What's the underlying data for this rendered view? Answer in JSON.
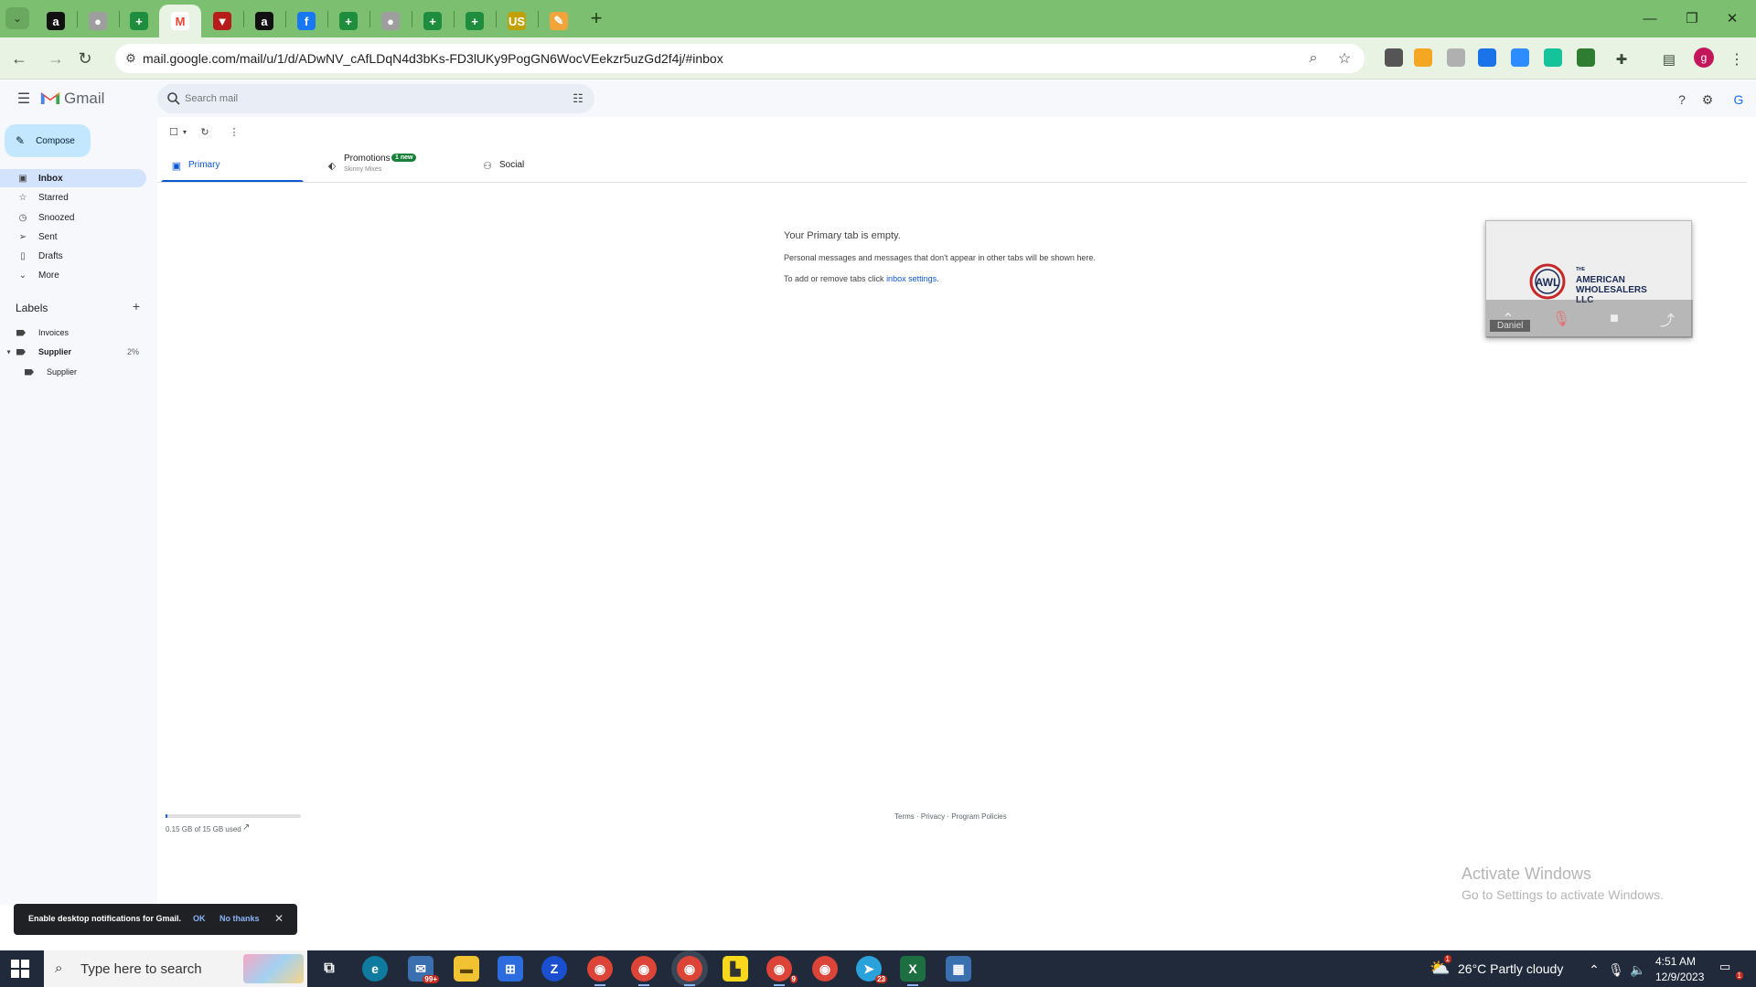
{
  "browser": {
    "address_bar": {
      "url": "mail.google.com/mail/u/1/d/ADwNV_cAfLDqN4d3bKs-FD3lUKy9PogGN6WocVEekzr5uzGd2f4j/#inbox"
    },
    "tabs": [
      {
        "icon": "amazon-icon",
        "glyph": "a",
        "color": "#111111"
      },
      {
        "icon": "globe-icon",
        "glyph": "●",
        "color": "#9e9e9e"
      },
      {
        "icon": "sheets-icon",
        "glyph": "+",
        "color": "#1e8e3e"
      },
      {
        "icon": "gmail-icon",
        "glyph": "M",
        "color": "#ea4335"
      },
      {
        "icon": "tradingview-icon",
        "glyph": "▼",
        "color": "#b71c1c"
      },
      {
        "icon": "amazon-icon",
        "glyph": "a",
        "color": "#111111"
      },
      {
        "icon": "facebook-icon",
        "glyph": "f",
        "color": "#1877f2"
      },
      {
        "icon": "sheets-icon",
        "glyph": "+",
        "color": "#1e8e3e"
      },
      {
        "icon": "globe-icon",
        "glyph": "●",
        "color": "#9e9e9e"
      },
      {
        "icon": "sheets-icon",
        "glyph": "+",
        "color": "#1e8e3e"
      },
      {
        "icon": "sheets-icon",
        "glyph": "+",
        "color": "#1e8e3e"
      },
      {
        "icon": "us-icon",
        "glyph": "US",
        "color": "#c1a100"
      },
      {
        "icon": "paint-icon",
        "glyph": "✎",
        "color": "#f2a33a"
      }
    ],
    "extensions": [
      {
        "icon": "honey-off-icon",
        "color": "#555555"
      },
      {
        "icon": "orange-ext-icon",
        "color": "#f5a623"
      },
      {
        "icon": "clip-ext-icon",
        "color": "#b0b0b0"
      },
      {
        "icon": "blue-ext-icon",
        "color": "#1a73e8"
      },
      {
        "icon": "zoom-ext-icon",
        "color": "#2d8cff"
      },
      {
        "icon": "grammarly-icon",
        "color": "#15c39a"
      },
      {
        "icon": "r-ext-icon",
        "color": "#2e7d32"
      }
    ],
    "profile_initial": "g"
  },
  "gmail": {
    "brand": "Gmail",
    "search": {
      "placeholder": "Search mail"
    },
    "compose_label": "Compose",
    "nav": [
      {
        "id": "inbox",
        "label": "Inbox",
        "icon": "inbox-icon",
        "glyph": "▣",
        "active": true
      },
      {
        "id": "starred",
        "label": "Starred",
        "icon": "star-icon",
        "glyph": "☆"
      },
      {
        "id": "snoozed",
        "label": "Snoozed",
        "icon": "clock-icon",
        "glyph": "◷"
      },
      {
        "id": "sent",
        "label": "Sent",
        "icon": "send-icon",
        "glyph": "➢"
      },
      {
        "id": "drafts",
        "label": "Drafts",
        "icon": "draft-icon",
        "glyph": "▯"
      },
      {
        "id": "more",
        "label": "More",
        "icon": "chevron-down-icon",
        "glyph": "⌄"
      }
    ],
    "labels_heading": "Labels",
    "labels": [
      {
        "label": "Invoices",
        "count": ""
      },
      {
        "label": "Supplier",
        "count": "2%",
        "bold": true
      },
      {
        "label": "Supplier",
        "count": "",
        "nested": true
      }
    ],
    "category_tabs": {
      "primary": "Primary",
      "promotions": "Promotions",
      "promotions_badge": "1 new",
      "promotions_sub": "Skinny Mixes",
      "social": "Social"
    },
    "empty": {
      "title": "Your Primary tab is empty.",
      "description": "Personal messages and messages that don't appear in other tabs will be shown here.",
      "settings_prefix": "To add or remove tabs click ",
      "settings_link": "inbox settings",
      "settings_suffix": "."
    },
    "storage": {
      "text": "0.15 GB of 15 GB used",
      "used_fraction": 0.01
    },
    "footer": "Terms · Privacy · Program Policies",
    "notification": {
      "text": "Enable desktop notifications for Gmail.",
      "ok": "OK",
      "no": "No thanks"
    }
  },
  "video_call": {
    "company_line1": "THE",
    "company_line2": "AMERICAN",
    "company_line3": "WHOLESALERS",
    "company_line4": "LLC",
    "logo_text": "AWL",
    "participant": "Daniel"
  },
  "watermark": {
    "title": "Activate Windows",
    "subtitle": "Go to Settings to activate Windows."
  },
  "taskbar": {
    "search_placeholder": "Type here to search",
    "weather": "26°C  Partly cloudy",
    "weather_badge": "1",
    "time": "4:51 AM",
    "date": "12/9/2023",
    "notifications_count": "1",
    "mail_badge": "99+",
    "chrome_badge": "9",
    "telegram_badge": "23"
  }
}
